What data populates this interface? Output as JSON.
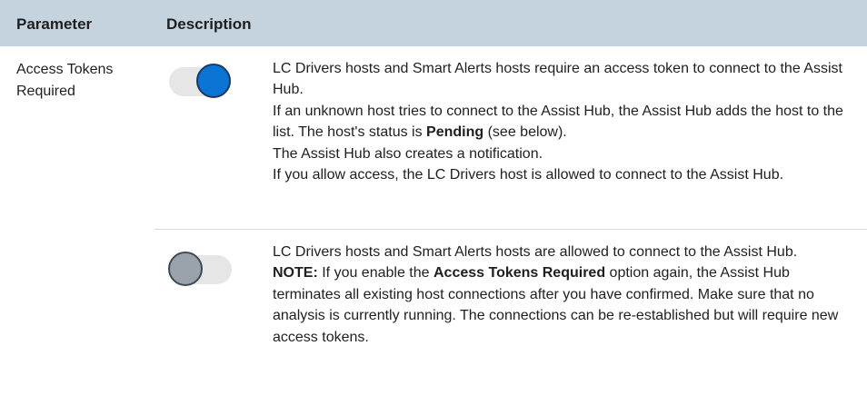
{
  "table": {
    "headers": {
      "parameter": "Parameter",
      "description": "Description"
    },
    "parameter_name": "Access Tokens Required",
    "rows": [
      {
        "toggle_state": "on",
        "lines": {
          "l1": "LC Drivers hosts and Smart Alerts hosts require an access token to connect to the Assist Hub.",
          "l2": "If an unknown host tries to connect to the Assist Hub, the Assist Hub adds the host to the list. The host's status is ",
          "l2_bold": "Pending",
          "l2_end": " (see below).",
          "l3": "The Assist Hub also creates a notification.",
          "l4": "If you allow access, the LC Drivers host is allowed to connect to the Assist Hub."
        }
      },
      {
        "toggle_state": "off",
        "lines": {
          "l1": "LC Drivers hosts and Smart Alerts hosts are allowed to connect to the Assist Hub.",
          "note_label": "NOTE:",
          "note_a": " If you enable the ",
          "note_bold": "Access Tokens Required",
          "note_b": " option again, the Assist Hub terminates all existing host connections after you have confirmed. Make sure that no analysis is currently running. The connections can be re-established but will require new access tokens."
        }
      }
    ]
  },
  "colors": {
    "header_bg": "#c5d3df",
    "toggle_on": "#0a74d4",
    "toggle_off": "#9aa2ac",
    "track": "#e6e6e6"
  },
  "icons": [
    "toggle-on-icon",
    "toggle-off-icon"
  ]
}
